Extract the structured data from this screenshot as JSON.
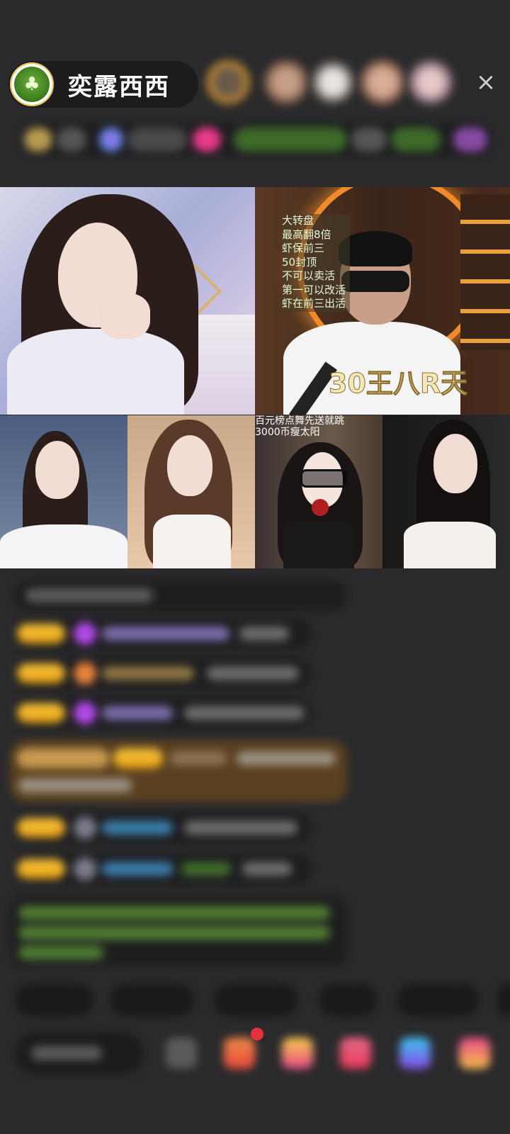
{
  "host": {
    "name": "奕露西西",
    "avatar_icon": "tree-icon"
  },
  "viewers": [
    "viewer-1",
    "viewer-2",
    "viewer-3",
    "viewer-4",
    "viewer-5"
  ],
  "close_icon_glyph": "×",
  "video": {
    "big_right": {
      "info_lines": [
        "大转盘",
        "最高翻8倍",
        "虾保前三",
        "50封顶",
        "不可以卖活",
        "第一可以改活",
        "虾在前三出活"
      ],
      "overlay": "30王八R天"
    },
    "small_3": {
      "caption_1": "百元榜点舞先送就跳",
      "caption_2": "3000币瘦太阳"
    }
  },
  "colors": {
    "background": "#2a2a2c",
    "badge": "#f0b428",
    "accent_green": "#74c84a"
  }
}
